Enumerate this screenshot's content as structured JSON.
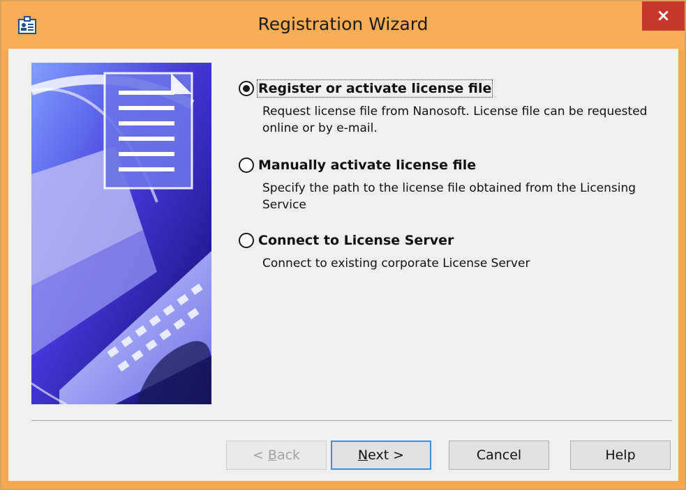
{
  "window": {
    "title": "Registration Wizard",
    "close_glyph": "×",
    "title_icon": "id-card-icon"
  },
  "options": [
    {
      "label": "Register or activate license file",
      "description": "Request license file from Nanosoft. License file can be requested online or by e-mail.",
      "selected": true
    },
    {
      "label": "Manually activate license file",
      "description": "Specify the path to the license file obtained from the Licensing Service",
      "selected": false
    },
    {
      "label": "Connect to License Server",
      "description": "Connect to existing corporate License Server",
      "selected": false
    }
  ],
  "buttons": {
    "back": {
      "prefix": "< ",
      "key": "B",
      "rest": "ack",
      "enabled": false
    },
    "next": {
      "key": "N",
      "rest": "ext >",
      "enabled": true
    },
    "cancel": {
      "label": "Cancel",
      "enabled": true
    },
    "help": {
      "label": "Help",
      "enabled": true
    }
  },
  "colors": {
    "titlebar": "#f9ad55",
    "close": "#c7382c",
    "default_button_border": "#3c8ee0"
  }
}
